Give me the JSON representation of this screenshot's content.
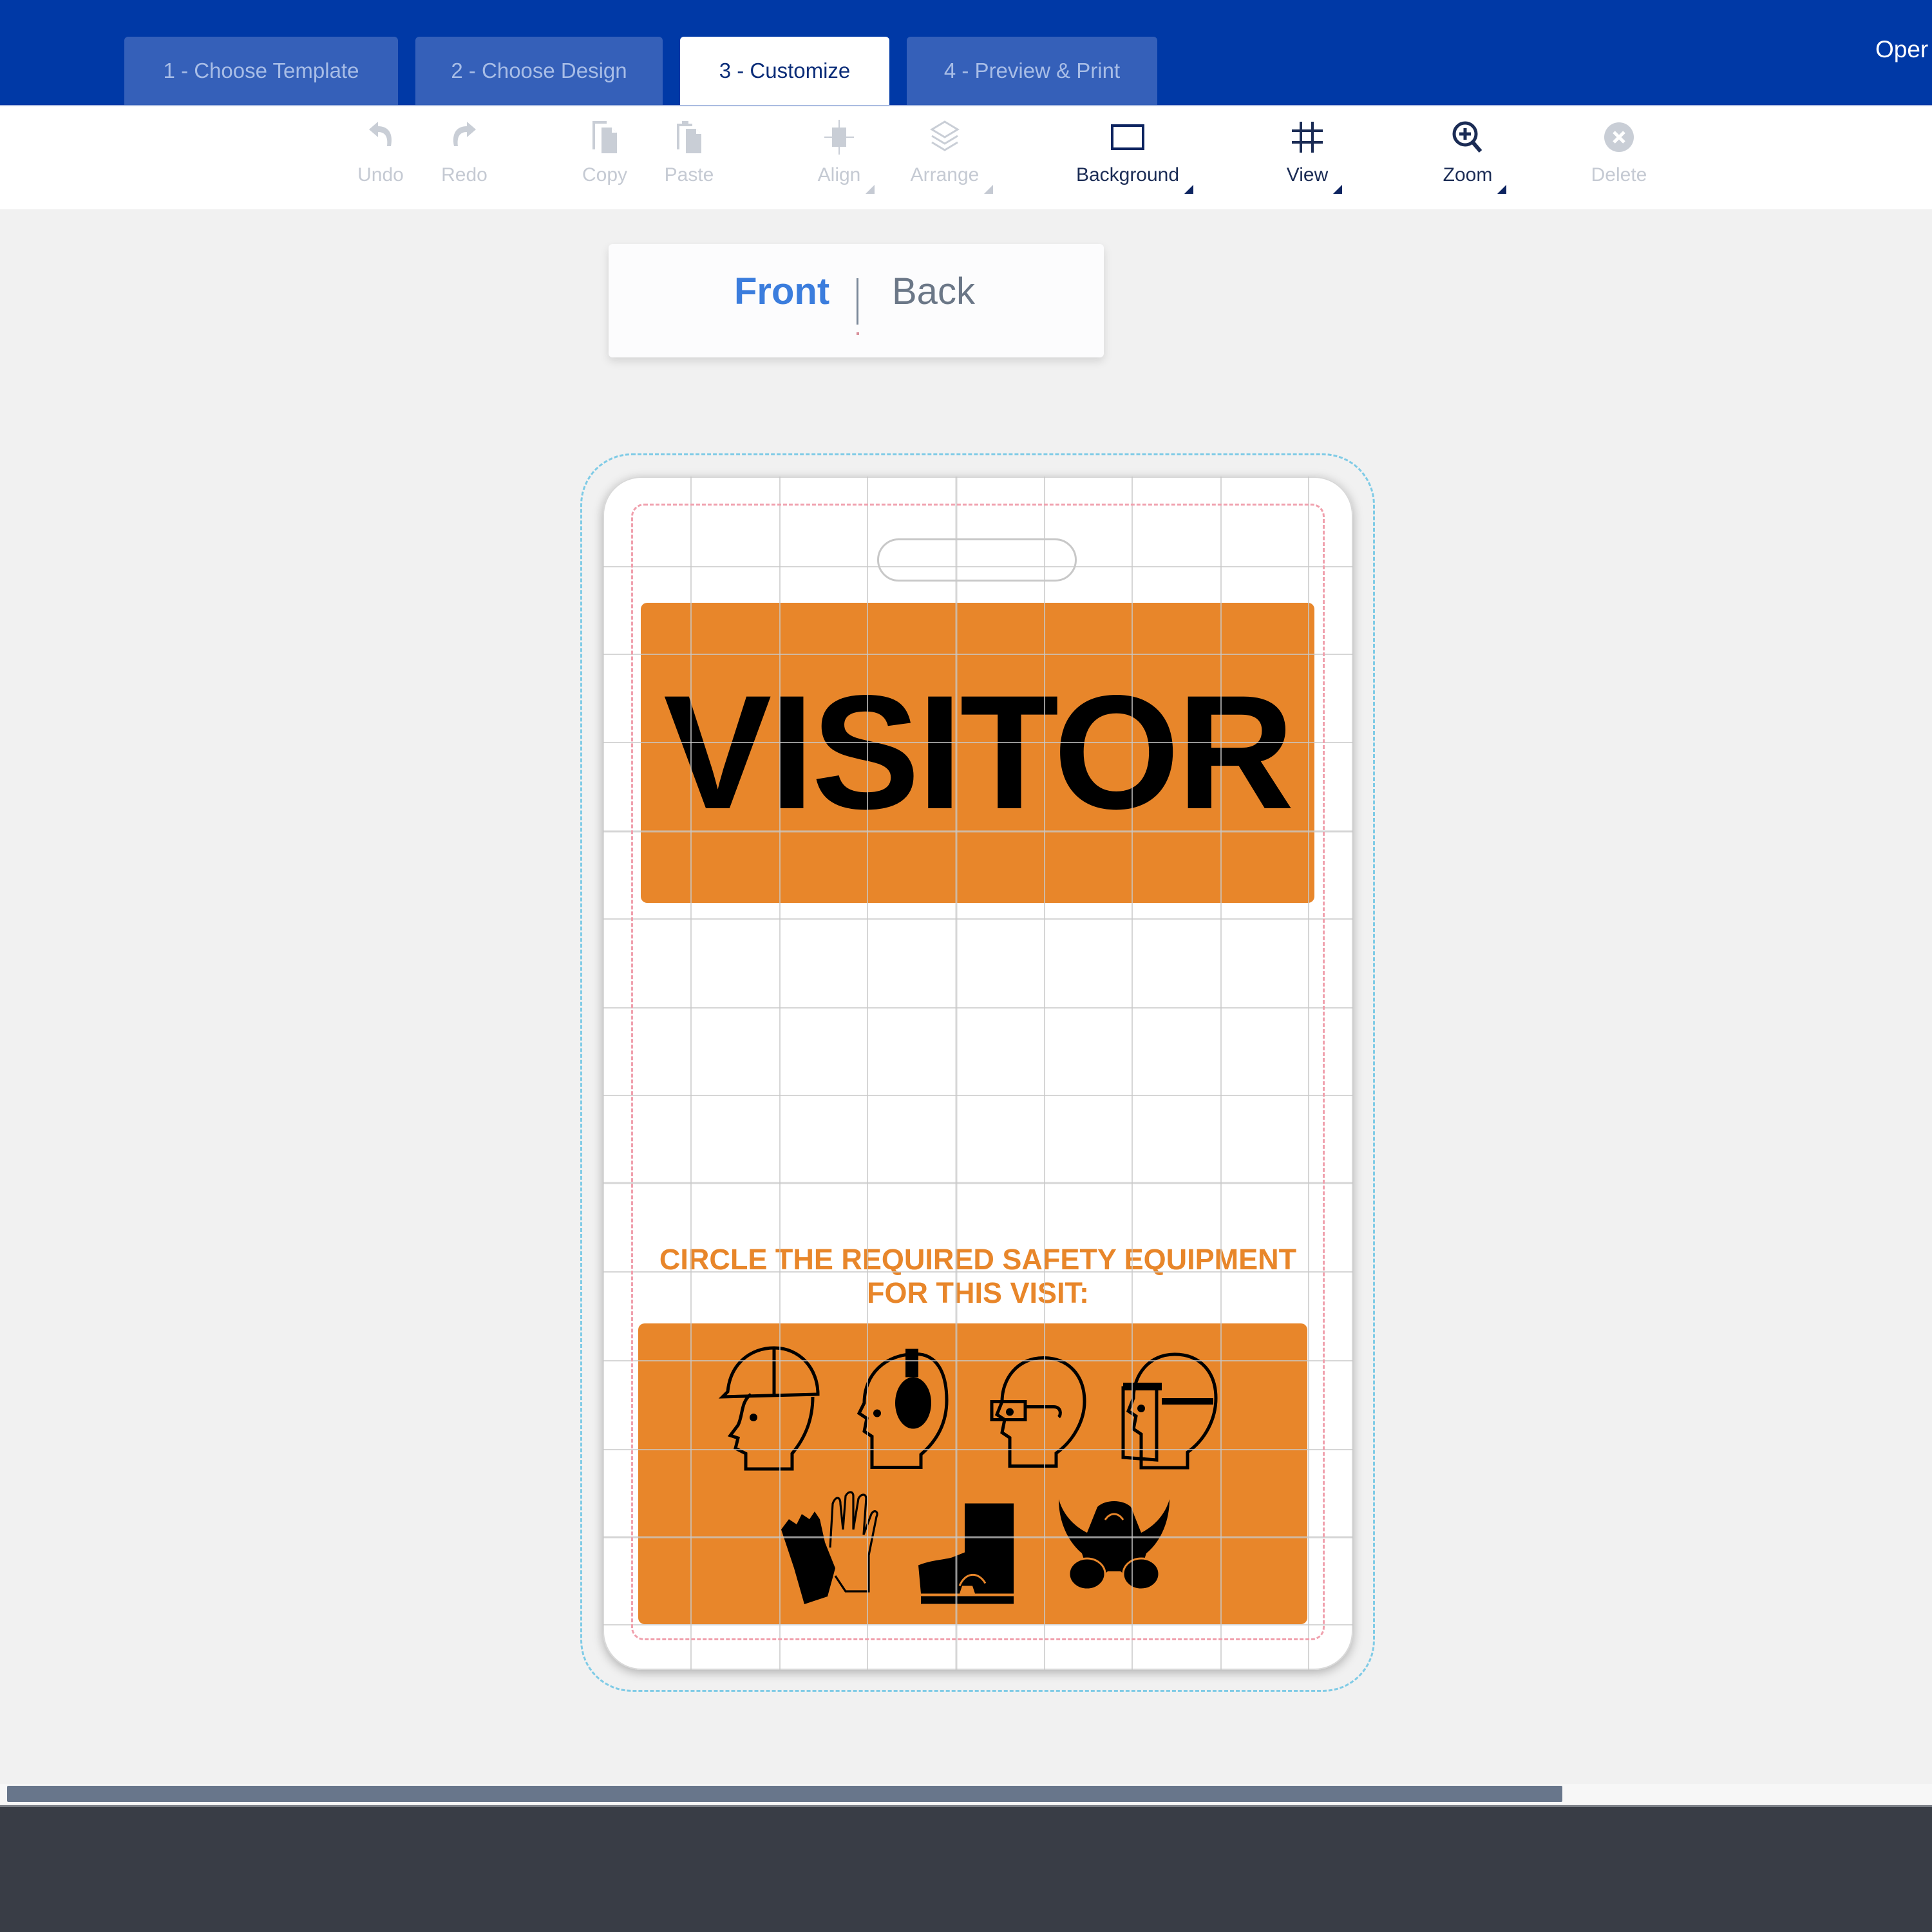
{
  "nav": {
    "tabs": [
      {
        "label": "1 - Choose Template",
        "active": false
      },
      {
        "label": "2 - Choose Design",
        "active": false
      },
      {
        "label": "3 - Customize",
        "active": true
      },
      {
        "label": "4 - Preview & Print",
        "active": false
      }
    ],
    "right_link": "Oper"
  },
  "toolbar": {
    "items": [
      {
        "label": "Undo",
        "icon": "undo-icon",
        "enabled": false,
        "dropdown": false
      },
      {
        "label": "Redo",
        "icon": "redo-icon",
        "enabled": false,
        "dropdown": false
      },
      {
        "label": "Copy",
        "icon": "copy-icon",
        "enabled": false,
        "dropdown": false
      },
      {
        "label": "Paste",
        "icon": "paste-icon",
        "enabled": false,
        "dropdown": false
      },
      {
        "label": "Align",
        "icon": "align-icon",
        "enabled": false,
        "dropdown": true
      },
      {
        "label": "Arrange",
        "icon": "layers-icon",
        "enabled": false,
        "dropdown": true
      },
      {
        "label": "Background",
        "icon": "rectangle-icon",
        "enabled": true,
        "dropdown": true
      },
      {
        "label": "View",
        "icon": "grid-icon",
        "enabled": true,
        "dropdown": true
      },
      {
        "label": "Zoom",
        "icon": "zoom-in-icon",
        "enabled": true,
        "dropdown": true
      },
      {
        "label": "Delete",
        "icon": "delete-icon",
        "enabled": false,
        "dropdown": false
      }
    ]
  },
  "side_switch": {
    "front": "Front",
    "back": "Back",
    "selected": "Front"
  },
  "card": {
    "headline": "VISITOR",
    "instruction": "CIRCLE THE REQUIRED SAFETY EQUIPMENT FOR THIS VISIT:",
    "ppe_icons": [
      "hard-hat-icon",
      "ear-protection-icon",
      "safety-glasses-icon",
      "face-shield-icon",
      "gloves-icon",
      "safety-boot-icon",
      "respirator-icon"
    ]
  },
  "colors": {
    "nav_bg": "#0039a6",
    "tab_inactive": "#3560b9",
    "accent_orange": "#e8862a",
    "front_active": "#3b7ddd",
    "footer_bg": "#393d46"
  }
}
